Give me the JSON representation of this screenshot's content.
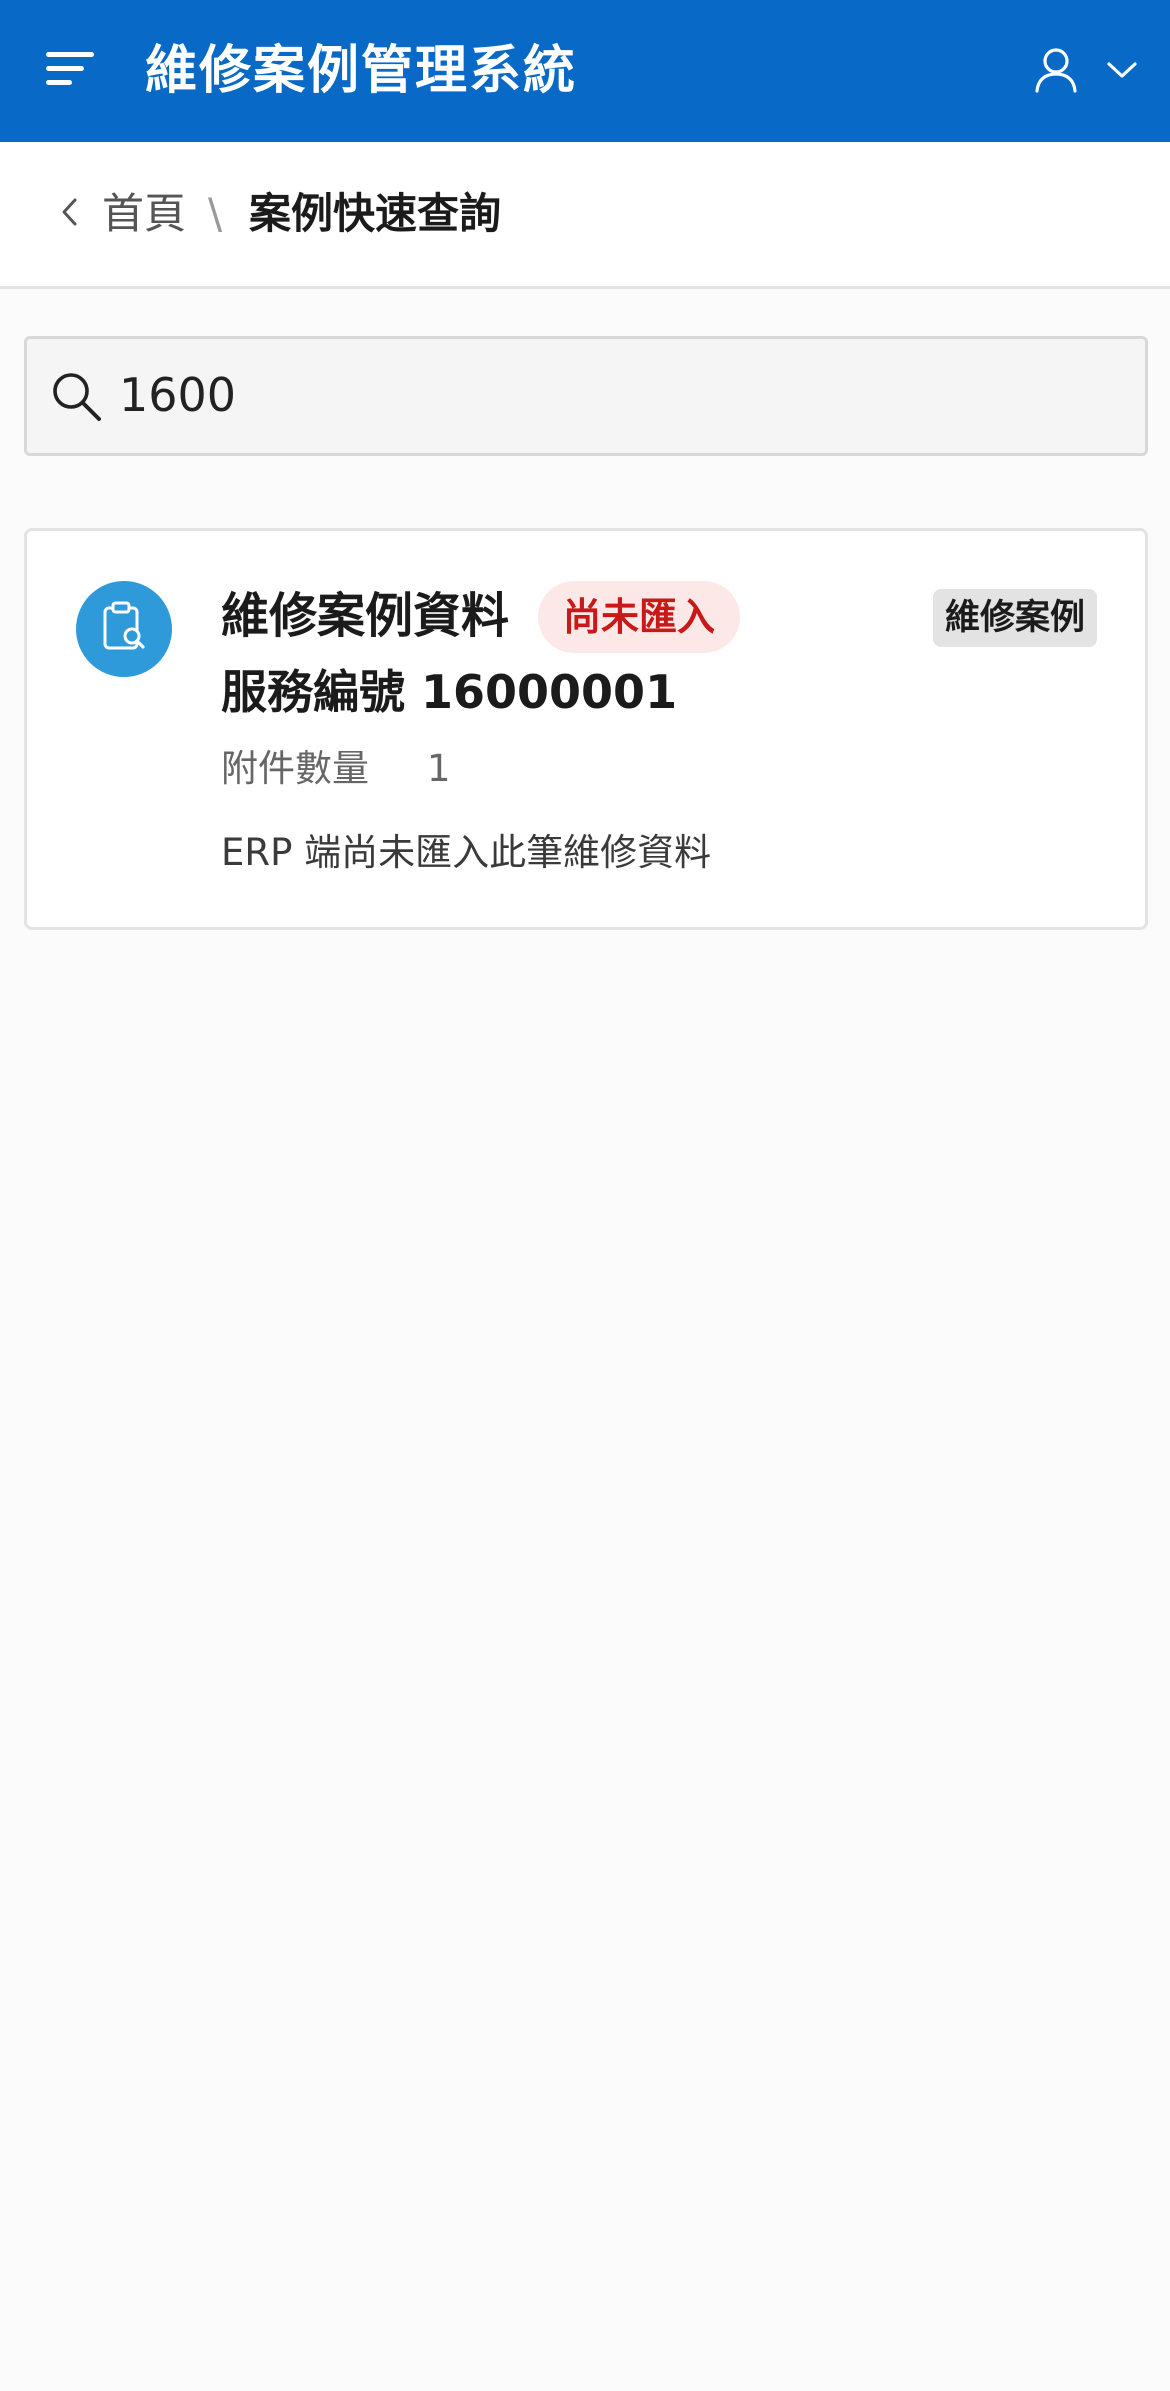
{
  "header": {
    "title": "維修案例管理系統",
    "background_color": "#0969c6",
    "menu_icon": "menu-icon",
    "user_icon": "user-icon",
    "dropdown_icon": "chevron-down-icon"
  },
  "breadcrumb": {
    "back_icon": "chevron-left-icon",
    "home_label": "首頁",
    "separator": "\\",
    "current_label": "案例快速查詢"
  },
  "search": {
    "value": "1600",
    "icon": "search-icon"
  },
  "results": [
    {
      "icon": "clipboard-search-icon",
      "title": "維修案例資料",
      "status_badge": "尚未匯入",
      "type_tag": "維修案例",
      "subtitle": "服務編號 16000001",
      "attachment_label": "附件數量",
      "attachment_count": "1",
      "note": "ERP 端尚未匯入此筆維修資料"
    }
  ]
}
